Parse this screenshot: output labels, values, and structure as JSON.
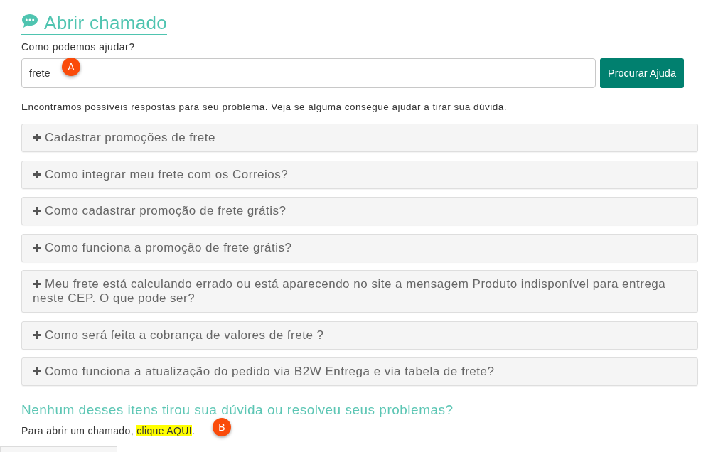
{
  "header": {
    "title": "Abrir chamado"
  },
  "search": {
    "label": "Como podemos ajudar?",
    "value": "frete",
    "button": "Procurar Ajuda"
  },
  "results_message": "Encontramos possíveis respostas para seu problema. Veja se alguma consegue ajudar a tirar sua dúvida.",
  "faq_items": [
    {
      "question": "Cadastrar promoções de frete",
      "expanded": false
    },
    {
      "question": "Como integrar meu frete com os Correios?",
      "expanded": false
    },
    {
      "question": "Como cadastrar promoção de frete grátis?",
      "expanded": false
    },
    {
      "question": "Como funciona a promoção de frete grátis?",
      "expanded": false
    },
    {
      "question": "Meu frete está calculando errado ou está aparecendo no site a mensagem Produto indisponível para entrega neste CEP. O que pode ser?",
      "expanded": false
    },
    {
      "question": "Como será feita a cobrança de valores de frete ?",
      "expanded": false
    },
    {
      "question": "Como funciona a atualização do pedido via B2W Entrega e via tabela de frete?",
      "expanded": false
    }
  ],
  "fallback": {
    "heading": "Nenhum desses itens tirou sua dúvida ou resolveu seus problemas?",
    "text": "Para abrir um chamado, ",
    "link": "clique AQUI",
    "text_end": "."
  },
  "annotations": [
    {
      "label": "A"
    },
    {
      "label": "B"
    }
  ]
}
